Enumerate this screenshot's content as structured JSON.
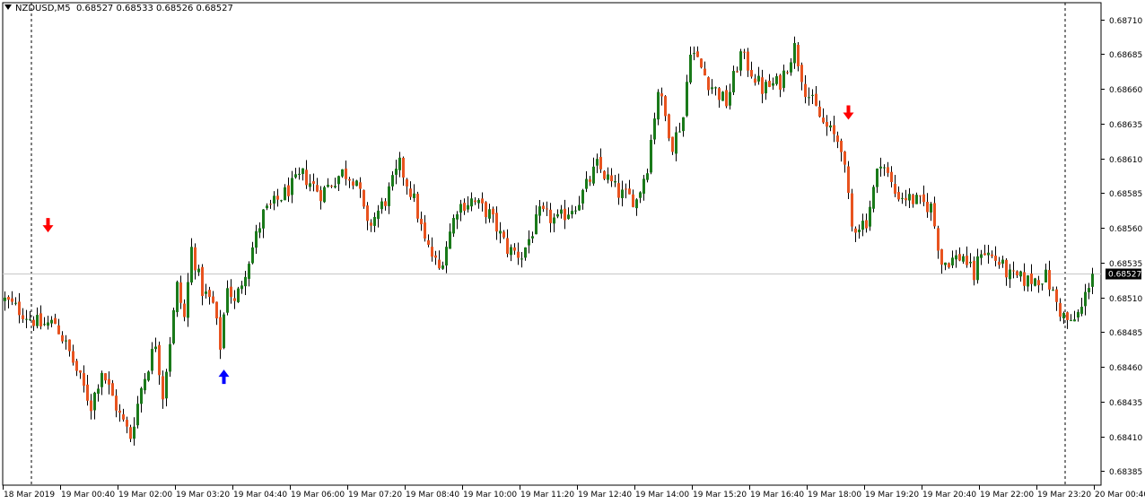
{
  "header": {
    "symbol_timeframe": "NZDUSD,M5",
    "ohlc": "0.68527 0.68533 0.68526 0.68527"
  },
  "colors": {
    "background": "#ffffff",
    "bull": "#1a7a1a",
    "bear": "#e8531f",
    "wick": "#000000",
    "current_price_line": "#c8c8c8",
    "current_price_label_bg": "#000000",
    "arrow_sell": "#ff0000",
    "arrow_buy": "#0000ff",
    "axis": "#000000"
  },
  "chart_data": {
    "type": "candlestick",
    "symbol": "NZDUSD",
    "timeframe": "M5",
    "y_range": [
      0.68375,
      0.68722
    ],
    "y_ticks": [
      "0.68710",
      "0.68685",
      "0.68660",
      "0.68635",
      "0.68610",
      "0.68585",
      "0.68560",
      "0.68535",
      "0.68510",
      "0.68485",
      "0.68460",
      "0.68435",
      "0.68410",
      "0.68385"
    ],
    "x_ticks": [
      "18 Mar 2019",
      "19 Mar 00:40",
      "19 Mar 02:00",
      "19 Mar 03:20",
      "19 Mar 04:40",
      "19 Mar 06:00",
      "19 Mar 07:20",
      "19 Mar 08:40",
      "19 Mar 10:00",
      "19 Mar 11:20",
      "19 Mar 12:40",
      "19 Mar 14:00",
      "19 Mar 15:20",
      "19 Mar 16:40",
      "19 Mar 18:00",
      "19 Mar 19:20",
      "19 Mar 20:40",
      "19 Mar 22:00",
      "19 Mar 23:20",
      "20 Mar 00:40"
    ],
    "current_price": "0.68527",
    "day_separators": [
      "19 Mar 2019",
      "20 Mar 2019"
    ],
    "signals": [
      {
        "type": "sell",
        "bar": 12,
        "price": 0.68562
      },
      {
        "type": "buy",
        "bar": 61,
        "price": 0.68453
      },
      {
        "type": "sell",
        "bar": 235,
        "price": 0.68643
      }
    ],
    "path": [
      [
        0,
        0.68508
      ],
      [
        10,
        0.6849
      ],
      [
        14,
        0.68492
      ],
      [
        18,
        0.6847
      ],
      [
        24,
        0.68432
      ],
      [
        27,
        0.68458
      ],
      [
        32,
        0.68425
      ],
      [
        35,
        0.6841
      ],
      [
        38,
        0.68445
      ],
      [
        42,
        0.68478
      ],
      [
        44,
        0.6844
      ],
      [
        48,
        0.68518
      ],
      [
        50,
        0.68495
      ],
      [
        52,
        0.68545
      ],
      [
        55,
        0.68515
      ],
      [
        58,
        0.68505
      ],
      [
        60,
        0.68475
      ],
      [
        62,
        0.6852
      ],
      [
        64,
        0.68505
      ],
      [
        67,
        0.6853
      ],
      [
        72,
        0.6857
      ],
      [
        78,
        0.68585
      ],
      [
        83,
        0.68598
      ],
      [
        88,
        0.68585
      ],
      [
        94,
        0.686
      ],
      [
        98,
        0.68595
      ],
      [
        101,
        0.6856
      ],
      [
        106,
        0.6858
      ],
      [
        110,
        0.68605
      ],
      [
        114,
        0.6858
      ],
      [
        117,
        0.6855
      ],
      [
        121,
        0.6853
      ],
      [
        126,
        0.68575
      ],
      [
        130,
        0.6858
      ],
      [
        135,
        0.6857
      ],
      [
        140,
        0.68545
      ],
      [
        144,
        0.6854
      ],
      [
        149,
        0.6857
      ],
      [
        154,
        0.68565
      ],
      [
        160,
        0.6858
      ],
      [
        165,
        0.68605
      ],
      [
        171,
        0.68585
      ],
      [
        176,
        0.6858
      ],
      [
        179,
        0.68605
      ],
      [
        182,
        0.6866
      ],
      [
        186,
        0.6862
      ],
      [
        189,
        0.6864
      ],
      [
        191,
        0.6869
      ],
      [
        196,
        0.68665
      ],
      [
        201,
        0.6865
      ],
      [
        205,
        0.68685
      ],
      [
        211,
        0.6866
      ],
      [
        216,
        0.68665
      ],
      [
        220,
        0.6869
      ],
      [
        223,
        0.6866
      ],
      [
        228,
        0.68635
      ],
      [
        233,
        0.6862
      ],
      [
        236,
        0.6856
      ],
      [
        240,
        0.68565
      ],
      [
        244,
        0.6861
      ],
      [
        248,
        0.68585
      ],
      [
        253,
        0.6858
      ],
      [
        258,
        0.68575
      ],
      [
        261,
        0.68535
      ],
      [
        267,
        0.6854
      ],
      [
        270,
        0.68525
      ],
      [
        272,
        0.68545
      ],
      [
        277,
        0.68535
      ],
      [
        280,
        0.68525
      ],
      [
        285,
        0.68522
      ],
      [
        290,
        0.68525
      ],
      [
        294,
        0.685
      ],
      [
        297,
        0.6849
      ],
      [
        300,
        0.68502
      ],
      [
        303,
        0.6853
      ]
    ]
  }
}
